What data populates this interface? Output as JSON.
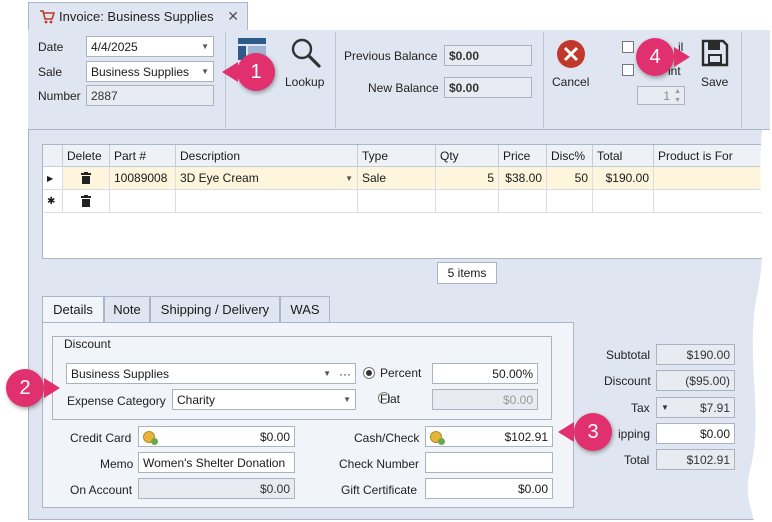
{
  "tab": {
    "title": "Invoice: Business Supplies",
    "close": "✕"
  },
  "header": {
    "date_label": "Date",
    "date_value": "4/4/2025",
    "sale_label": "Sale",
    "sale_value": "Business Supplies",
    "number_label": "Number",
    "number_value": "2887"
  },
  "toolbar": {
    "lookup_label": "Lookup",
    "previous_balance_label": "Previous Balance",
    "previous_balance_value": "$0.00",
    "new_balance_label": "New Balance",
    "new_balance_value": "$0.00",
    "cancel_label": "Cancel",
    "email_partial": "il",
    "print_partial": "int",
    "copies_value": "1",
    "save_label": "Save"
  },
  "grid": {
    "columns": [
      "Delete",
      "Part #",
      "Description",
      "Type",
      "Qty",
      "Price",
      "Disc%",
      "Total",
      "Product is For"
    ],
    "rows": [
      {
        "part": "10089008",
        "description": "3D Eye Cream",
        "type": "Sale",
        "qty": "5",
        "price": "$38.00",
        "disc": "50",
        "total": "$190.00",
        "for": ""
      }
    ],
    "item_count": "5 items"
  },
  "lower_tabs": [
    "Details",
    "Note",
    "Shipping / Delivery",
    "WAS"
  ],
  "discount": {
    "legend": "Discount",
    "source_value": "Business Supplies",
    "percent_label": "Percent",
    "percent_value": "50.00%",
    "expense_label": "Expense Category",
    "expense_value": "Charity",
    "flat_label": "Flat",
    "flat_value": "$0.00"
  },
  "payment": {
    "credit_card_label": "Credit Card",
    "credit_card_value": "$0.00",
    "memo_label": "Memo",
    "memo_value": "Women's Shelter Donation",
    "on_account_label": "On Account",
    "on_account_value": "$0.00",
    "cash_check_label": "Cash/Check",
    "cash_check_value": "$102.91",
    "check_number_label": "Check Number",
    "check_number_value": "",
    "gift_certificate_label": "Gift Certificate",
    "gift_certificate_value": "$0.00"
  },
  "totals": {
    "subtotal_label": "Subtotal",
    "subtotal_value": "$190.00",
    "discount_label": "Discount",
    "discount_value": "($95.00)",
    "tax_label": "Tax",
    "tax_value": "$7.91",
    "shipping_label": "ipping",
    "shipping_value": "$0.00",
    "total_label": "Total",
    "total_value": "$102.91"
  },
  "callouts": [
    "1",
    "2",
    "3",
    "4"
  ],
  "colors": {
    "panel": "#dfe6f1",
    "callout": "#e0316e",
    "cancel": "#c0392b",
    "selected_row": "#fdf6dd"
  }
}
